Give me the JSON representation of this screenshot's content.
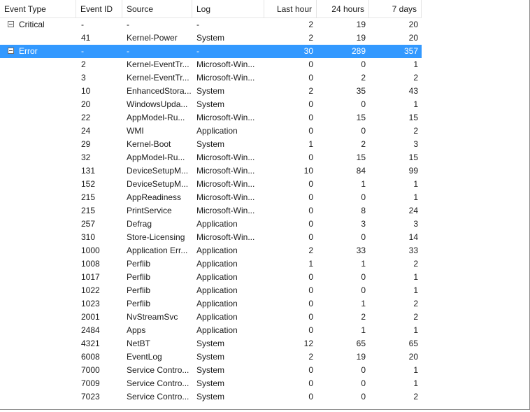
{
  "columns": [
    {
      "key": "type",
      "label": "Event Type"
    },
    {
      "key": "id",
      "label": "Event ID"
    },
    {
      "key": "source",
      "label": "Source"
    },
    {
      "key": "log",
      "label": "Log"
    },
    {
      "key": "h1",
      "label": "Last hour"
    },
    {
      "key": "h24",
      "label": "24 hours"
    },
    {
      "key": "d7",
      "label": "7 days"
    }
  ],
  "rows": [
    {
      "group": true,
      "type": "Critical",
      "id": "-",
      "source": "-",
      "log": "-",
      "h1": "2",
      "h24": "19",
      "d7": "20"
    },
    {
      "id": "41",
      "source": "Kernel-Power",
      "log": "System",
      "h1": "2",
      "h24": "19",
      "d7": "20"
    },
    {
      "group": true,
      "selected": true,
      "type": "Error",
      "id": "-",
      "source": "-",
      "log": "-",
      "h1": "30",
      "h24": "289",
      "d7": "357"
    },
    {
      "id": "2",
      "source": "Kernel-EventTr...",
      "log": "Microsoft-Win...",
      "h1": "0",
      "h24": "0",
      "d7": "1"
    },
    {
      "id": "3",
      "source": "Kernel-EventTr...",
      "log": "Microsoft-Win...",
      "h1": "0",
      "h24": "2",
      "d7": "2"
    },
    {
      "id": "10",
      "source": "EnhancedStora...",
      "log": "System",
      "h1": "2",
      "h24": "35",
      "d7": "43"
    },
    {
      "id": "20",
      "source": "WindowsUpda...",
      "log": "System",
      "h1": "0",
      "h24": "0",
      "d7": "1"
    },
    {
      "id": "22",
      "source": "AppModel-Ru...",
      "log": "Microsoft-Win...",
      "h1": "0",
      "h24": "15",
      "d7": "15"
    },
    {
      "id": "24",
      "source": "WMI",
      "log": "Application",
      "h1": "0",
      "h24": "0",
      "d7": "2"
    },
    {
      "id": "29",
      "source": "Kernel-Boot",
      "log": "System",
      "h1": "1",
      "h24": "2",
      "d7": "3"
    },
    {
      "id": "32",
      "source": "AppModel-Ru...",
      "log": "Microsoft-Win...",
      "h1": "0",
      "h24": "15",
      "d7": "15"
    },
    {
      "id": "131",
      "source": "DeviceSetupM...",
      "log": "Microsoft-Win...",
      "h1": "10",
      "h24": "84",
      "d7": "99"
    },
    {
      "id": "152",
      "source": "DeviceSetupM...",
      "log": "Microsoft-Win...",
      "h1": "0",
      "h24": "1",
      "d7": "1"
    },
    {
      "id": "215",
      "source": "AppReadiness",
      "log": "Microsoft-Win...",
      "h1": "0",
      "h24": "0",
      "d7": "1"
    },
    {
      "id": "215",
      "source": "PrintService",
      "log": "Microsoft-Win...",
      "h1": "0",
      "h24": "8",
      "d7": "24"
    },
    {
      "id": "257",
      "source": "Defrag",
      "log": "Application",
      "h1": "0",
      "h24": "3",
      "d7": "3"
    },
    {
      "id": "310",
      "source": "Store-Licensing",
      "log": "Microsoft-Win...",
      "h1": "0",
      "h24": "0",
      "d7": "14"
    },
    {
      "id": "1000",
      "source": "Application Err...",
      "log": "Application",
      "h1": "2",
      "h24": "33",
      "d7": "33"
    },
    {
      "id": "1008",
      "source": "Perflib",
      "log": "Application",
      "h1": "1",
      "h24": "1",
      "d7": "2"
    },
    {
      "id": "1017",
      "source": "Perflib",
      "log": "Application",
      "h1": "0",
      "h24": "0",
      "d7": "1"
    },
    {
      "id": "1022",
      "source": "Perflib",
      "log": "Application",
      "h1": "0",
      "h24": "0",
      "d7": "1"
    },
    {
      "id": "1023",
      "source": "Perflib",
      "log": "Application",
      "h1": "0",
      "h24": "1",
      "d7": "2"
    },
    {
      "id": "2001",
      "source": "NvStreamSvc",
      "log": "Application",
      "h1": "0",
      "h24": "2",
      "d7": "2"
    },
    {
      "id": "2484",
      "source": "Apps",
      "log": "Application",
      "h1": "0",
      "h24": "1",
      "d7": "1"
    },
    {
      "id": "4321",
      "source": "NetBT",
      "log": "System",
      "h1": "12",
      "h24": "65",
      "d7": "65"
    },
    {
      "id": "6008",
      "source": "EventLog",
      "log": "System",
      "h1": "2",
      "h24": "19",
      "d7": "20"
    },
    {
      "id": "7000",
      "source": "Service Contro...",
      "log": "System",
      "h1": "0",
      "h24": "0",
      "d7": "1"
    },
    {
      "id": "7009",
      "source": "Service Contro...",
      "log": "System",
      "h1": "0",
      "h24": "0",
      "d7": "1"
    },
    {
      "id": "7023",
      "source": "Service Contro...",
      "log": "System",
      "h1": "0",
      "h24": "0",
      "d7": "2"
    }
  ],
  "colors": {
    "selection": "#3399ff",
    "selection_text": "#ffffff"
  }
}
